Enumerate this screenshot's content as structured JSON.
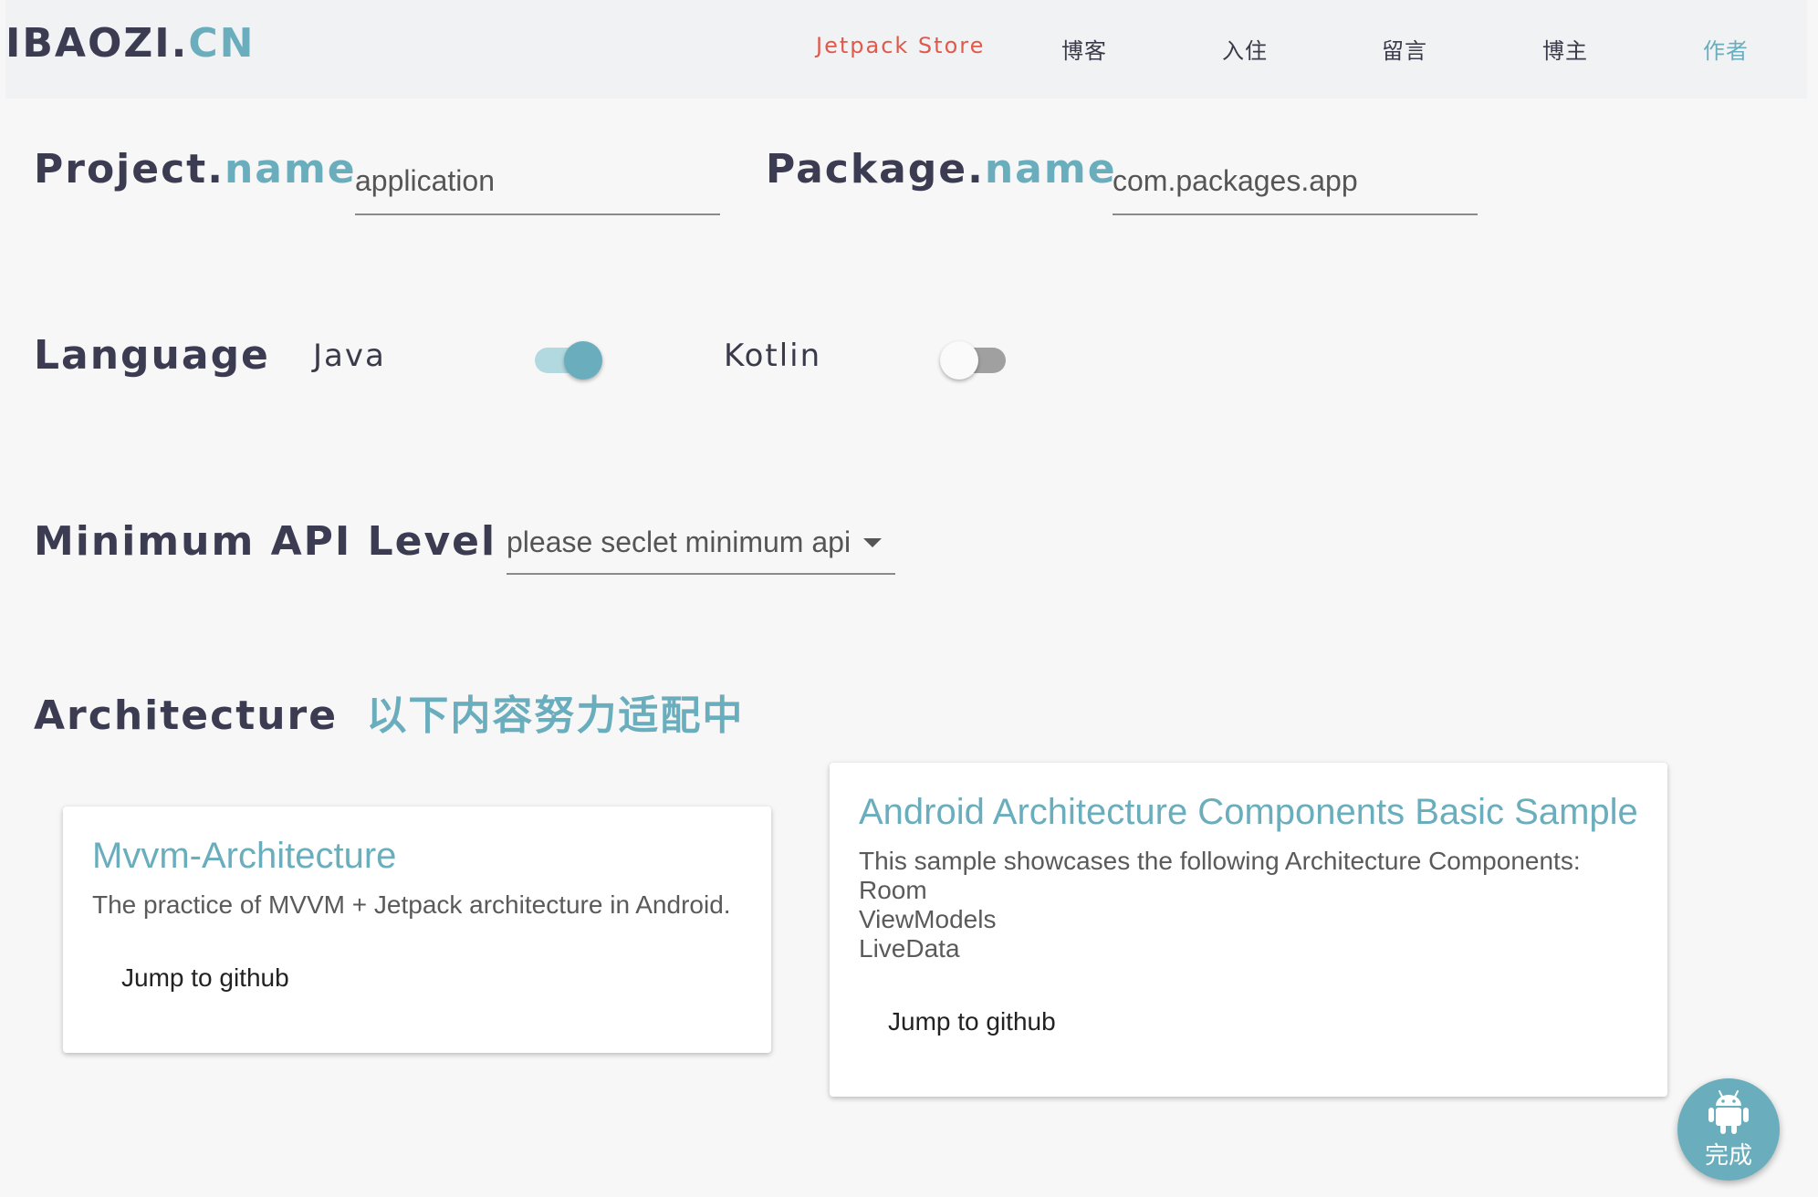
{
  "header": {
    "brand_main": "IBAOZI.",
    "brand_accent": "CN",
    "nav": [
      "Jetpack Store",
      "博客",
      "入住",
      "留言",
      "博主",
      "作者"
    ]
  },
  "project": {
    "label_main": "Project.",
    "label_accent": "name",
    "value": "application"
  },
  "package": {
    "label_main": "Package.",
    "label_accent": "name",
    "value": "com.packages.app"
  },
  "language": {
    "label": "Language",
    "options": [
      {
        "name": "Java",
        "enabled": true
      },
      {
        "name": "Kotlin",
        "enabled": false
      }
    ]
  },
  "min_api": {
    "label": "Minimum API Level",
    "placeholder": "please seclet minimum api"
  },
  "architecture": {
    "label": "Architecture",
    "note": "以下内容努力适配中",
    "cards": [
      {
        "title": "Mvvm-Architecture",
        "description": [
          "The practice of MVVM + Jetpack architecture in Android."
        ],
        "button": "Jump to github"
      },
      {
        "title": "Android Architecture Components Basic Sample",
        "description": [
          "This sample showcases the following Architecture Components:",
          "Room",
          "ViewModels",
          "LiveData"
        ],
        "button": "Jump to github"
      }
    ]
  },
  "fab": {
    "icon": "android-icon",
    "label": "完成"
  },
  "colors": {
    "accent": "#6aaebd",
    "brand_dark": "#3b3c52",
    "store_red": "#e0594a"
  }
}
